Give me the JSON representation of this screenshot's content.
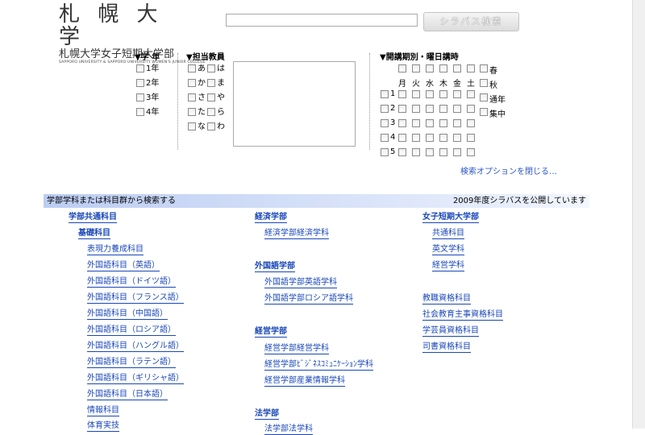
{
  "logo": {
    "main": "札 幌 大 学",
    "sub": "札幌大学女子短期大学部",
    "en": "SAPPORO UNIVERSITY & SAPPORO UNIVERSITY WOMEN'S JUNIOR COLLEGE"
  },
  "search": {
    "input_value": "",
    "button_label": "シラバス検索"
  },
  "grade": {
    "heading": "▼学 年",
    "items": [
      "1年",
      "2年",
      "3年",
      "4年"
    ]
  },
  "teacher": {
    "heading": "▼担当教員",
    "kana": [
      [
        "あ",
        "は"
      ],
      [
        "か",
        "ま"
      ],
      [
        "さ",
        "や"
      ],
      [
        "た",
        "ら"
      ],
      [
        "な",
        "わ"
      ]
    ]
  },
  "schedule": {
    "heading": "▼開講期別・曜日講時",
    "days": [
      "月",
      "火",
      "水",
      "木",
      "金",
      "土"
    ],
    "periods": [
      "1",
      "2",
      "3",
      "4",
      "5"
    ],
    "terms": [
      "春",
      "秋",
      "通年",
      "集中"
    ],
    "close_link": "検索オプションを閉じる…"
  },
  "bar": {
    "left": "学部学科または科目群から検索する",
    "right": "2009年度シラバスを公開しています"
  },
  "col1": {
    "top": "学部共通科目",
    "sub": "基礎科目",
    "items": [
      "表現力養成科目",
      "外国語科目（英語）",
      "外国語科目（ドイツ語）",
      "外国語科目（フランス語）",
      "外国語科目（中国語）",
      "外国語科目（ロシア語）",
      "外国語科目（ハングル語）",
      "外国語科目（ラテン語）",
      "外国語科目（ギリシャ語）",
      "外国語科目（日本語）",
      "情報科目",
      "体育実技"
    ]
  },
  "col2": {
    "g1": {
      "title": "経済学部",
      "items": [
        "経済学部経済学科"
      ]
    },
    "g2": {
      "title": "外国語学部",
      "items": [
        "外国語学部英語学科",
        "外国語学部ロシア語学科"
      ]
    },
    "g3": {
      "title": "経営学部",
      "items": [
        "経営学部経営学科",
        "経営学部ﾋﾞｼﾞﾈｽｺﾐｭﾆｹｰｼｮﾝ学科",
        "経営学部産業情報学科"
      ]
    },
    "g4": {
      "title": "法学部",
      "items": [
        "法学部法学科"
      ]
    }
  },
  "col3": {
    "title": "女子短期大学部",
    "items": [
      "共通科目",
      "英文学科",
      "経営学科"
    ],
    "extra": [
      "教職資格科目",
      "社会教育主事資格科目",
      "学芸員資格科目",
      "司書資格科目"
    ]
  }
}
